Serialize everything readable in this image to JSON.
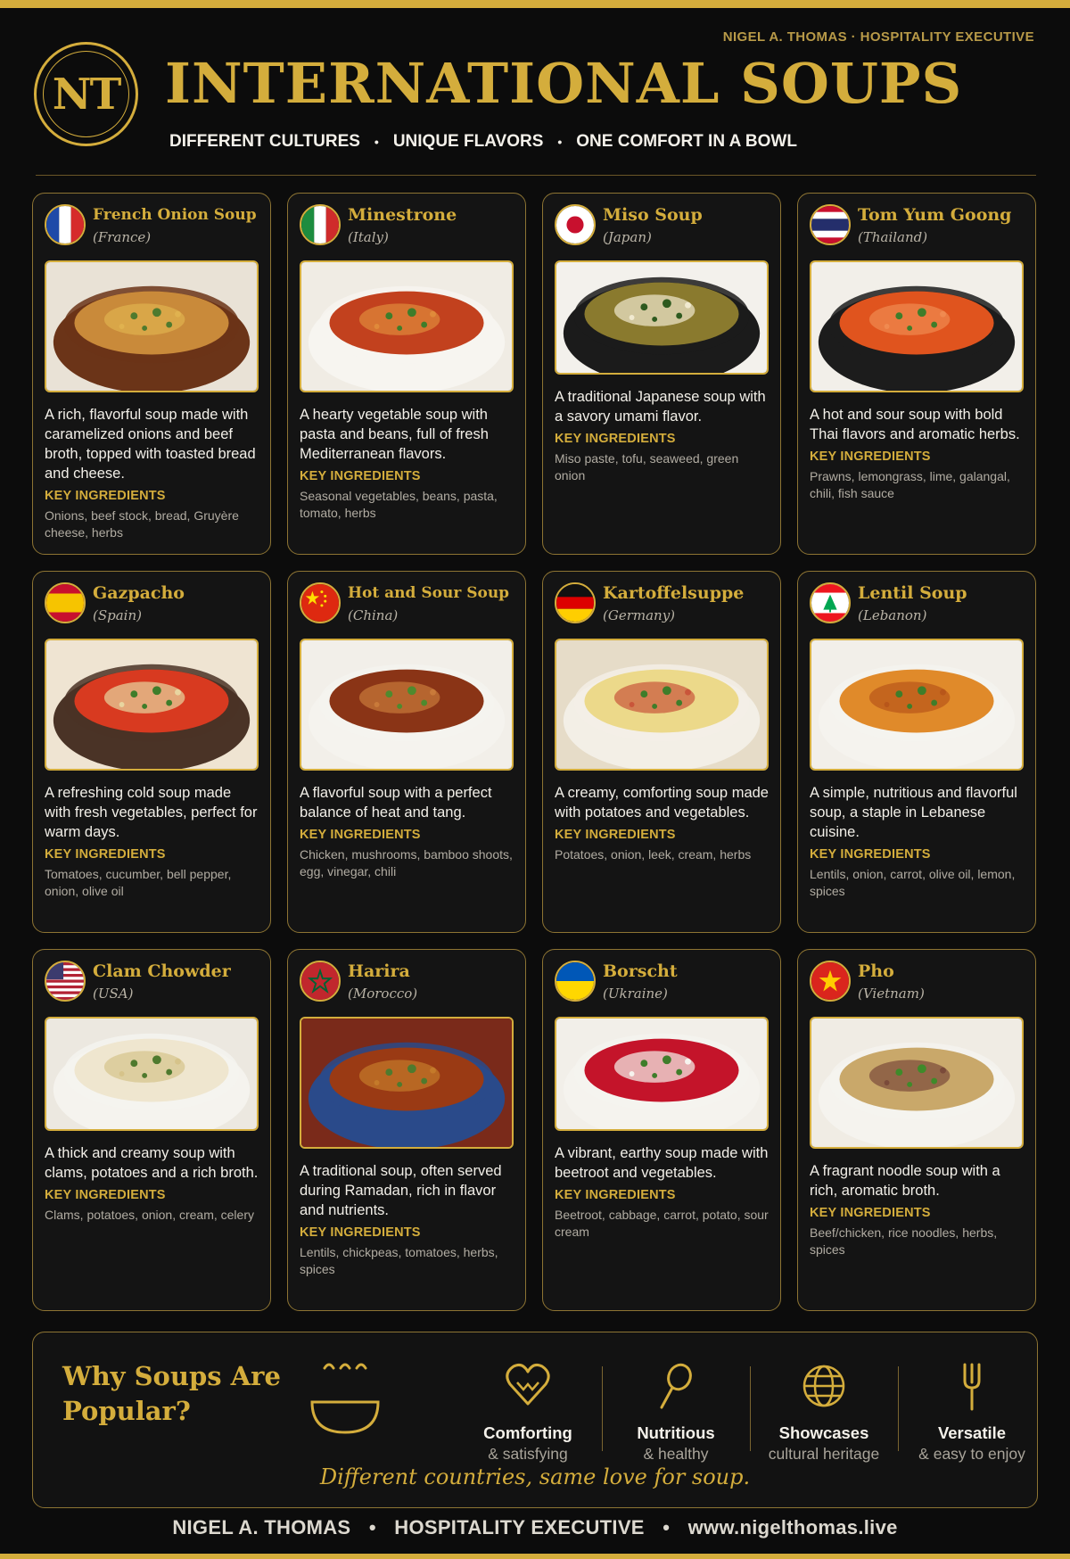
{
  "header": {
    "byline": "NIGEL A. THOMAS · HOSPITALITY EXECUTIVE",
    "logo_text": "NT",
    "title": "INTERNATIONAL SOUPS",
    "tagline": [
      "DIFFERENT CULTURES",
      "UNIQUE FLAVORS",
      "ONE COMFORT IN A BOWL"
    ],
    "separator": "•"
  },
  "key_label": "KEY INGREDIENTS",
  "soups": [
    {
      "name": "French Onion Soup",
      "country": "(France)",
      "flag": "france-flag-icon",
      "photo": "french-onion-soup-photo",
      "desc": "A rich, flavorful soup made with caramelized onions and beef broth, topped with toasted bread and cheese.",
      "ingredients": "Onions, beef stock, bread, Gruyère cheese, herbs"
    },
    {
      "name": "Minestrone",
      "country": "(Italy)",
      "flag": "italy-flag-icon",
      "photo": "minestrone-photo",
      "desc": "A hearty vegetable soup with pasta and beans, full of fresh Mediterranean flavors.",
      "ingredients": "Seasonal vegetables, beans, pasta, tomato, herbs"
    },
    {
      "name": "Miso Soup",
      "country": "(Japan)",
      "flag": "japan-flag-icon",
      "photo": "miso-soup-photo",
      "desc": "A traditional Japanese soup with a savory umami flavor.",
      "ingredients": "Miso paste, tofu, seaweed, green onion"
    },
    {
      "name": "Tom Yum Goong",
      "country": "(Thailand)",
      "flag": "thailand-flag-icon",
      "photo": "tom-yum-goong-photo",
      "desc": "A hot and sour soup with bold Thai flavors and aromatic herbs.",
      "ingredients": "Prawns, lemongrass, lime, galangal, chili, fish sauce"
    },
    {
      "name": "Gazpacho",
      "country": "(Spain)",
      "flag": "spain-flag-icon",
      "photo": "gazpacho-photo",
      "desc": "A refreshing cold soup made with fresh vegetables, perfect for warm days.",
      "ingredients": "Tomatoes, cucumber, bell pepper, onion, olive oil"
    },
    {
      "name": "Hot and Sour Soup",
      "country": "(China)",
      "flag": "china-flag-icon",
      "photo": "hot-and-sour-soup-photo",
      "desc": "A flavorful soup with a perfect balance of heat and tang.",
      "ingredients": "Chicken, mushrooms, bamboo shoots, egg, vinegar, chili"
    },
    {
      "name": "Kartoffelsuppe",
      "country": "(Germany)",
      "flag": "germany-flag-icon",
      "photo": "kartoffelsuppe-photo",
      "desc": "A creamy, comforting soup made with potatoes and vegetables.",
      "ingredients": "Potatoes, onion, leek, cream, herbs"
    },
    {
      "name": "Lentil Soup",
      "country": "(Lebanon)",
      "flag": "lebanon-flag-icon",
      "photo": "lentil-soup-photo",
      "desc": "A simple, nutritious and flavorful soup, a staple in Lebanese cuisine.",
      "ingredients": "Lentils, onion, carrot, olive oil, lemon, spices"
    },
    {
      "name": "Clam Chowder",
      "country": "(USA)",
      "flag": "usa-flag-icon",
      "photo": "clam-chowder-photo",
      "desc": "A thick and creamy soup with clams, potatoes and a rich broth.",
      "ingredients": "Clams, potatoes, onion, cream, celery"
    },
    {
      "name": "Harira",
      "country": "(Morocco)",
      "flag": "morocco-flag-icon",
      "photo": "harira-photo",
      "desc": "A traditional soup, often served during Ramadan, rich in flavor and nutrients.",
      "ingredients": "Lentils, chickpeas, tomatoes, herbs, spices"
    },
    {
      "name": "Borscht",
      "country": "(Ukraine)",
      "flag": "ukraine-flag-icon",
      "photo": "borscht-photo",
      "desc": "A vibrant, earthy soup made with beetroot and vegetables.",
      "ingredients": "Beetroot, cabbage, carrot, potato, sour cream"
    },
    {
      "name": "Pho",
      "country": "(Vietnam)",
      "flag": "vietnam-flag-icon",
      "photo": "pho-photo",
      "desc": "A fragrant noodle soup with a rich, aromatic broth.",
      "ingredients": "Beef/chicken, rice noodles, herbs, spices"
    }
  ],
  "why": {
    "title_line1": "Why Soups Are",
    "title_line2": "Popular?",
    "features": [
      {
        "icon": "heart-icon",
        "title": "Comforting",
        "sub": "& satisfying"
      },
      {
        "icon": "spoon-leaf-icon",
        "title": "Nutritious",
        "sub": "& healthy"
      },
      {
        "icon": "globe-icon",
        "title": "Showcases",
        "sub": "cultural heritage"
      },
      {
        "icon": "fork-icon",
        "title": "Versatile",
        "sub": "& easy to enjoy"
      }
    ],
    "slogan": "Different countries, same love for soup."
  },
  "footer": {
    "name": "NIGEL A. THOMAS",
    "role": "HOSPITALITY EXECUTIVE",
    "site": "www.nigelthomas.live",
    "separator": "•"
  },
  "colors": {
    "accent": "#d4ad3c",
    "background": "#0c0c0c",
    "card": "#141414"
  }
}
